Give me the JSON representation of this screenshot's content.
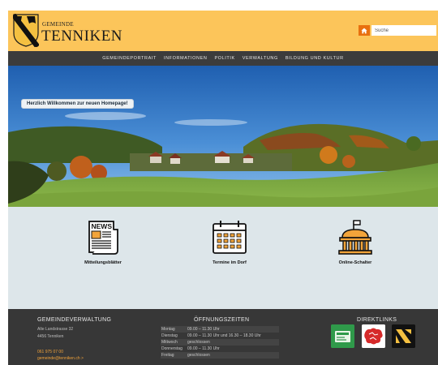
{
  "header": {
    "brand_top": "GEMEINDE",
    "brand_name": "TENNIKEN",
    "home_icon": "home-icon",
    "search_placeholder": "Suche"
  },
  "nav": {
    "items": [
      {
        "label": "Gemeindeportrait"
      },
      {
        "label": "Informationen"
      },
      {
        "label": "Politik"
      },
      {
        "label": "Verwaltung"
      },
      {
        "label": "Bildung und Kultur"
      }
    ]
  },
  "hero": {
    "welcome": "Herzlich Willkommen zur neuen Homepage!"
  },
  "quicklinks": [
    {
      "label": "Mitteilungsblätter",
      "icon": "newspaper-icon",
      "icon_text": "NEWS"
    },
    {
      "label": "Termine im Dorf",
      "icon": "calendar-icon"
    },
    {
      "label": "Online-Schalter",
      "icon": "town-hall-icon"
    }
  ],
  "footer": {
    "admin": {
      "title": "GEMEINDEVERWALTUNG",
      "street": "Alte Landstrasse 32",
      "city": "4456 Tenniken",
      "phone": "061 975 07 00",
      "email": "gemeinde@tenniken.ch >"
    },
    "hours": {
      "title": "ÖFFNUNGSZEITEN",
      "rows": [
        {
          "day": "Montag",
          "time": "09.00 – 11.30 Uhr"
        },
        {
          "day": "Dienstag",
          "time": "09.00 – 11.30 Uhr und 16.30 – 18.30 Uhr"
        },
        {
          "day": "Mittwoch",
          "time": "geschlossen"
        },
        {
          "day": "Donnerstag",
          "time": "09.00 – 11.30 Uhr"
        },
        {
          "day": "Freitag",
          "time": "geschlossen"
        }
      ]
    },
    "direktlinks": {
      "title": "DIREKTLINKS",
      "links": [
        {
          "icon": "green-card-icon"
        },
        {
          "icon": "canton-map-icon"
        },
        {
          "icon": "yellow-black-logo-icon"
        }
      ]
    }
  },
  "colors": {
    "header_bg": "#fcc55a",
    "nav_bg": "#3c3c3c",
    "footer_bg": "#373737",
    "accent_orange": "#e8700f",
    "quick_bg": "#dde6ea"
  }
}
